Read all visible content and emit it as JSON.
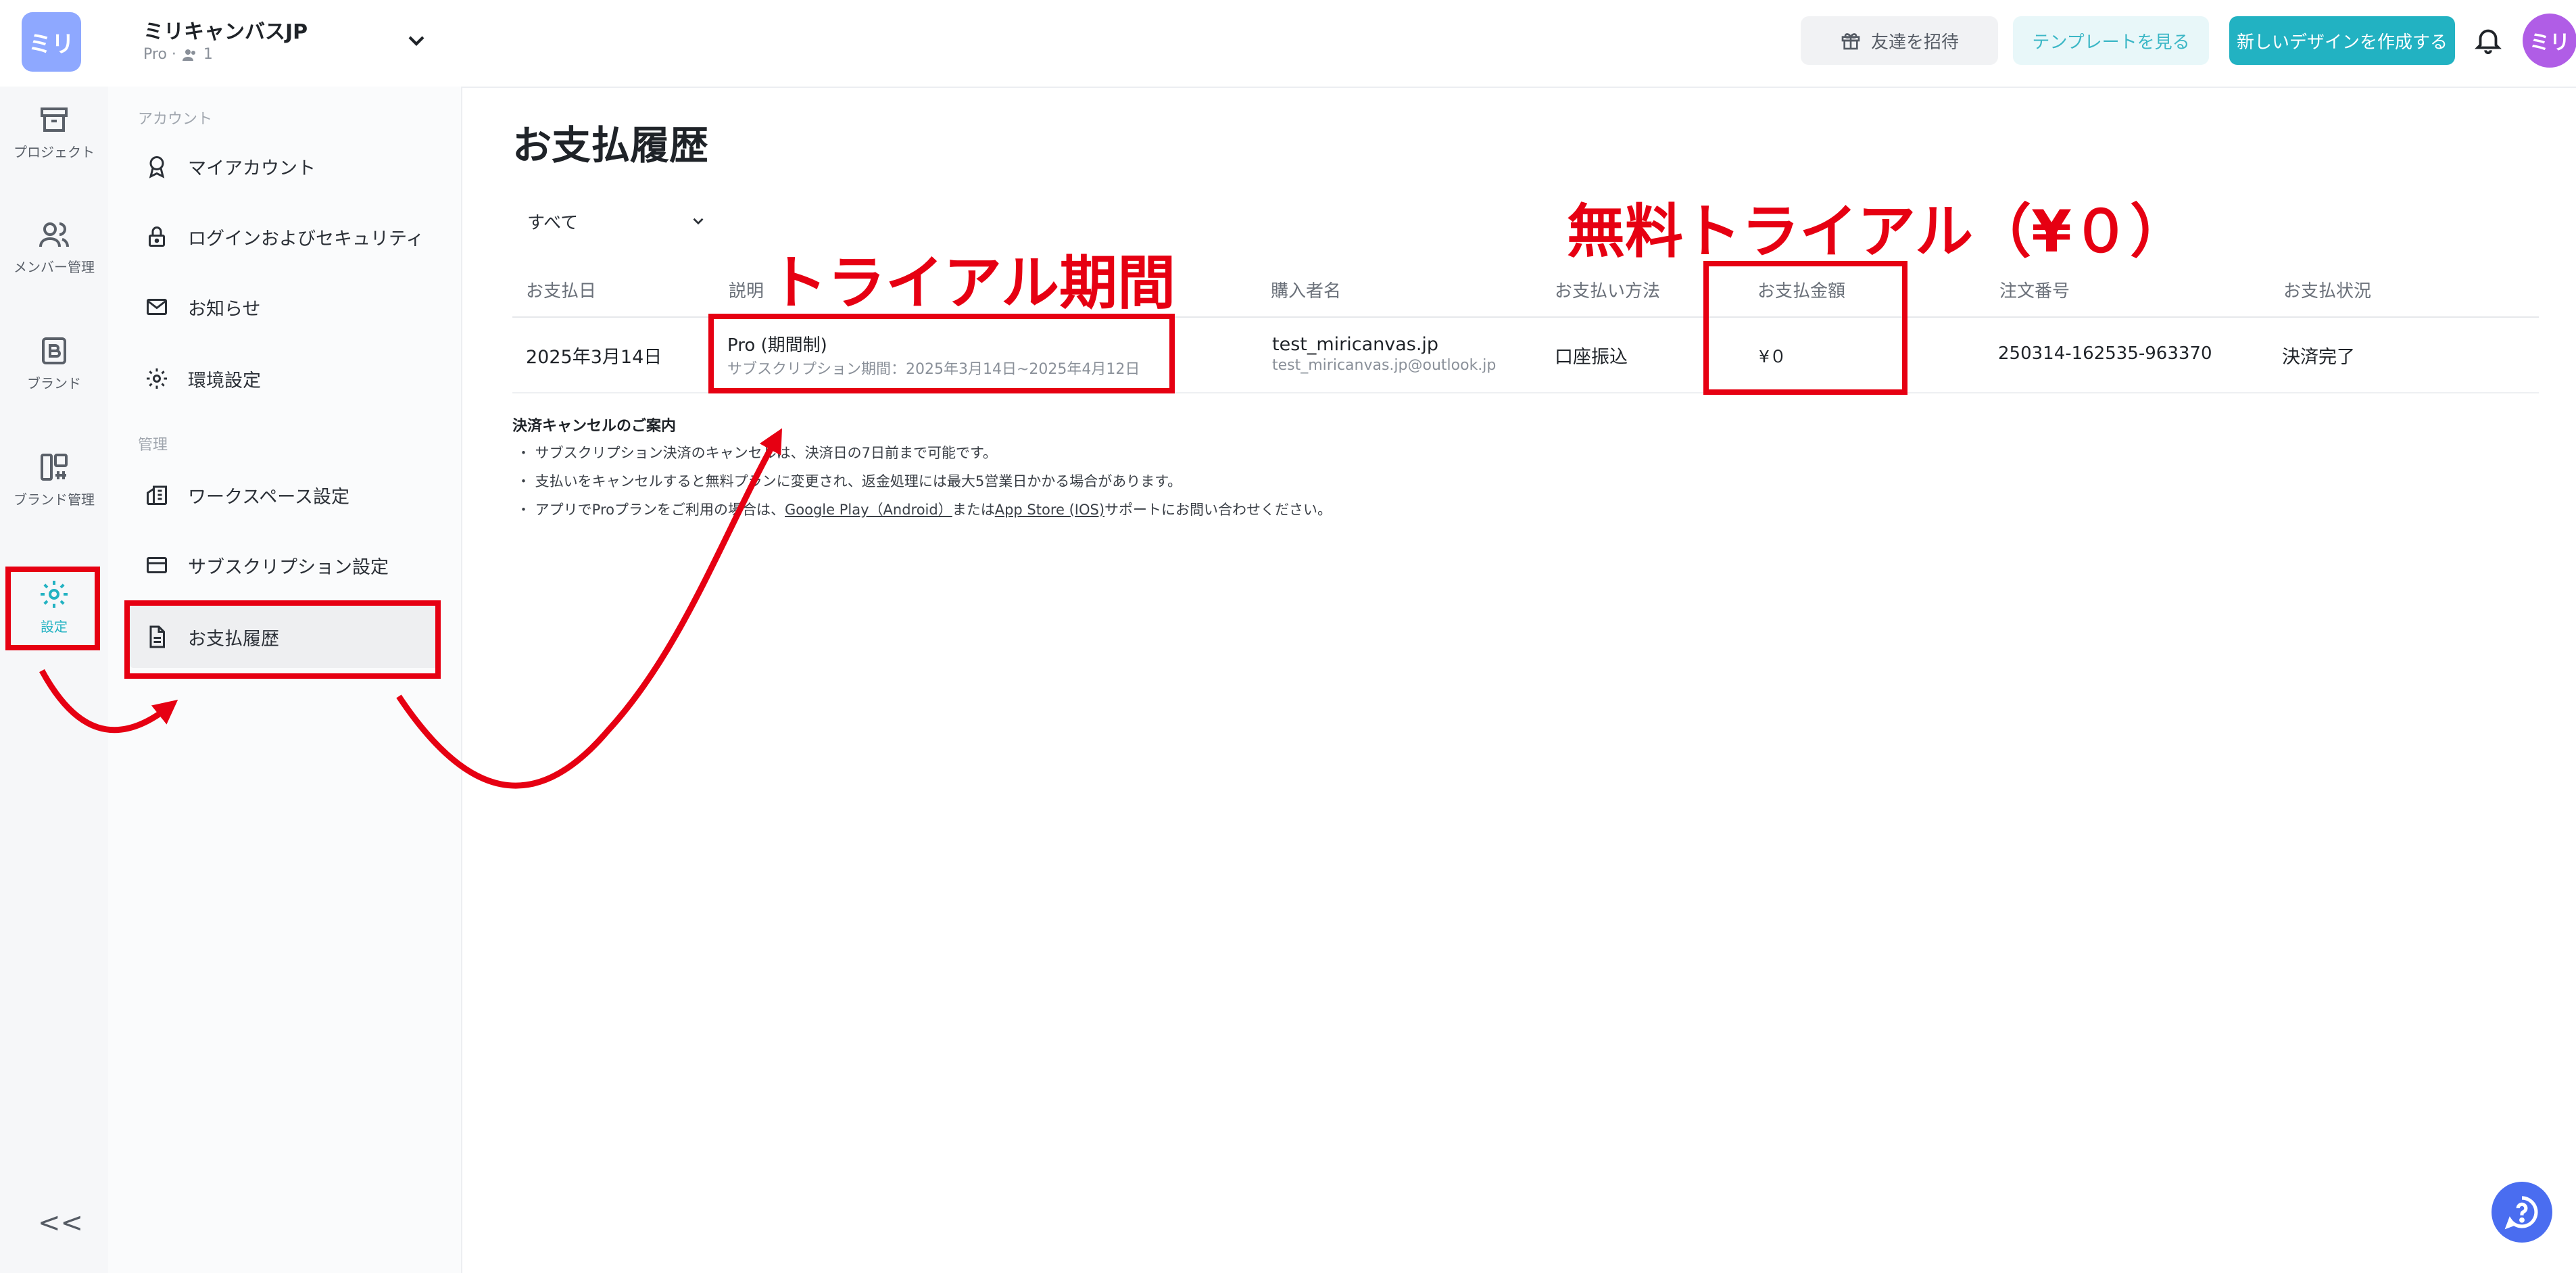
{
  "workspace": {
    "avatar_text": "ミリ",
    "name": "ミリキャンバスJP",
    "plan": "Pro ·",
    "member_count": "1"
  },
  "header": {
    "invite_label": "友達を招待",
    "template_label": "テンプレートを見る",
    "new_design_label": "新しいデザインを作成する",
    "user_avatar_text": "ミリ"
  },
  "rail": {
    "items": [
      {
        "label": "プロジェクト",
        "icon": "archive-icon"
      },
      {
        "label": "メンバー管理",
        "icon": "users-icon"
      },
      {
        "label": "ブランド",
        "icon": "brand-icon"
      },
      {
        "label": "ブランド管理",
        "icon": "brand-manage-icon"
      },
      {
        "label": "設定",
        "icon": "gear-icon"
      }
    ],
    "collapse_label": "<<"
  },
  "submenu": {
    "section_account": "アカウント",
    "section_admin": "管理",
    "items": [
      {
        "label": "マイアカウント"
      },
      {
        "label": "ログインおよびセキュリティ"
      },
      {
        "label": "お知らせ"
      },
      {
        "label": "環境設定"
      },
      {
        "label": "ワークスペース設定"
      },
      {
        "label": "サブスクリプション設定"
      },
      {
        "label": "お支払履歴"
      }
    ]
  },
  "main": {
    "title": "お支払履歴",
    "filter_value": "すべて",
    "columns": [
      "お支払日",
      "説明",
      "購入者名",
      "お支払い方法",
      "お支払金額",
      "注文番号",
      "お支払状況"
    ],
    "rows": [
      {
        "date": "2025年3月14日",
        "description": "Pro (期間制)",
        "description_sub": "サブスクリプション期間：2025年3月14日~2025年4月12日",
        "buyer": "test_miricanvas.jp",
        "buyer_email": "test_miricanvas.jp@outlook.jp",
        "method": "口座振込",
        "amount": "¥０",
        "order_no": "250314-162535-963370",
        "status": "決済完了"
      }
    ],
    "notice": {
      "title": "決済キャンセルのご案内",
      "line1": "・ サブスクリプション決済のキャンセルは、決済日の7日前まで可能です。",
      "line2": "・ 支払いをキャンセルすると無料プランに変更され、返金処理には最大5営業日かかる場合があります。",
      "line3_prefix": "・ アプリでProプランをご利用の場合は、",
      "link_android": "Google Play（Android）",
      "line3_mid": "または",
      "link_ios": "App Store (IOS)",
      "line3_suffix": "サポートにお問い合わせください。"
    }
  },
  "annotations": {
    "trial_period": "トライアル期間",
    "free_trial": "無料トライアル（¥０）",
    "color": "#e60012"
  },
  "colors": {
    "accent": "#22b2c2",
    "workspace_avatar": "#8ea8ff",
    "user_avatar": "#b05de6",
    "help_button": "#4a6df0"
  }
}
